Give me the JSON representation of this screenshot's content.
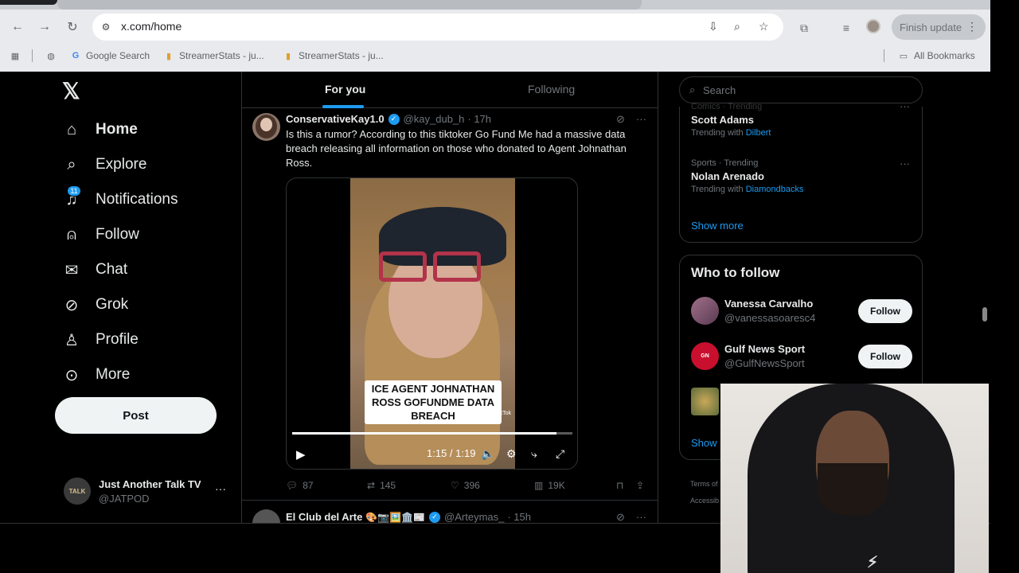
{
  "browser": {
    "url": "x.com/home",
    "finish_update": "Finish update",
    "bookmarks": [
      {
        "label": "Google Search"
      },
      {
        "label": "StreamerStats - ju..."
      },
      {
        "label": "StreamerStats - ju..."
      }
    ],
    "all_bookmarks": "All Bookmarks"
  },
  "nav": {
    "items": [
      {
        "label": "Home",
        "icon": "home-icon"
      },
      {
        "label": "Explore",
        "icon": "search-icon"
      },
      {
        "label": "Notifications",
        "icon": "bell-icon",
        "badge": "11"
      },
      {
        "label": "Follow",
        "icon": "person-plus-icon"
      },
      {
        "label": "Chat",
        "icon": "mail-icon"
      },
      {
        "label": "Grok",
        "icon": "grok-icon"
      },
      {
        "label": "Profile",
        "icon": "person-icon"
      },
      {
        "label": "More",
        "icon": "more-circle-icon"
      }
    ],
    "post_label": "Post",
    "account": {
      "name": "Just Another Talk TV",
      "handle": "@JATPOD",
      "avatar_text": "TALK"
    }
  },
  "timeline": {
    "tabs": [
      "For you",
      "Following"
    ],
    "tweet": {
      "name": "ConservativeKay1.0",
      "handle": "@kay_dub_h",
      "time": "· 17h",
      "text": "Is this a rumor? According to this tiktoker Go Fund Me had a massive data breach releasing all information on those who donated to Agent Johnathan Ross.",
      "video_overlay": "ICE AGENT JOHNATHAN ROSS GOFUNDME DATA BREACH",
      "tiktok_tag": "TikTok",
      "video_time": "1:15 / 1:19",
      "video_progress": 0.944,
      "replies": "87",
      "reposts": "145",
      "likes": "396",
      "views": "19K"
    },
    "tweet2": {
      "name": "El Club del Arte",
      "emojis": "🎨📷🖼️🏛️📰",
      "handle": "@Arteymas_",
      "time": "· 15h"
    }
  },
  "sidebar": {
    "search_placeholder": "Search",
    "trends": [
      {
        "context": "Comics · Trending",
        "name": "Scott Adams",
        "with_label": "Trending with",
        "with": "Dilbert"
      },
      {
        "context": "Sports · Trending",
        "name": "Nolan Arenado",
        "with_label": "Trending with",
        "with": "Diamondbacks"
      }
    ],
    "show_more": "Show more",
    "who_to_follow_title": "Who to follow",
    "who_to_follow": [
      {
        "name": "Vanessa Carvalho",
        "handle": "@vanessasoaresc4",
        "button": "Follow"
      },
      {
        "name": "Gulf News Sport",
        "handle": "@GulfNewsSport",
        "button": "Follow"
      }
    ],
    "show_label": "Show",
    "footer": [
      "Terms of",
      "Accessib"
    ]
  },
  "colors": {
    "accent": "#1d9bf0",
    "background": "#000000",
    "text": "#e7e9ea",
    "muted": "#71767b"
  }
}
